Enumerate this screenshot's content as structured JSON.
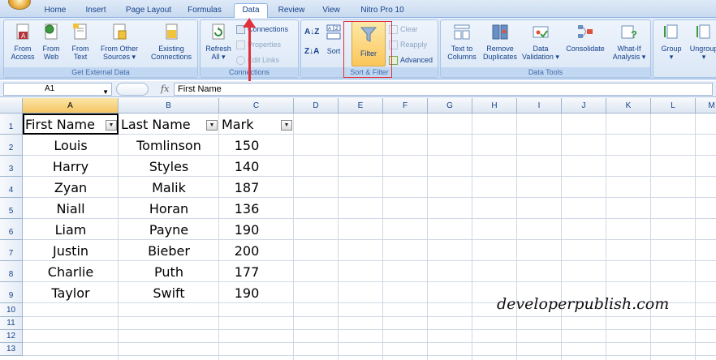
{
  "tabs": [
    "Home",
    "Insert",
    "Page Layout",
    "Formulas",
    "Data",
    "Review",
    "View",
    "Nitro Pro 10"
  ],
  "active_tab": "Data",
  "ribbon": {
    "get_external_data": {
      "label": "Get External Data",
      "from_access": [
        "From",
        "Access"
      ],
      "from_web": [
        "From",
        "Web"
      ],
      "from_text": [
        "From",
        "Text"
      ],
      "from_other": [
        "From Other",
        "Sources ▾"
      ],
      "existing": [
        "Existing",
        "Connections"
      ]
    },
    "connections": {
      "label": "Connections",
      "refresh": [
        "Refresh",
        "All ▾"
      ],
      "connections": "Connections",
      "properties": "Properties",
      "edit_links": "Edit Links"
    },
    "sort_filter": {
      "label": "Sort & Filter",
      "sort_az": "A↓Z",
      "sort_za": "Z↓A",
      "sort": "Sort",
      "filter": "Filter",
      "clear": "Clear",
      "reapply": "Reapply",
      "advanced": "Advanced"
    },
    "data_tools": {
      "label": "Data Tools",
      "text_to_columns": [
        "Text to",
        "Columns"
      ],
      "remove_duplicates": [
        "Remove",
        "Duplicates"
      ],
      "data_validation": [
        "Data",
        "Validation ▾"
      ],
      "consolidate": "Consolidate",
      "what_if": [
        "What-If",
        "Analysis ▾"
      ]
    },
    "outline": {
      "group": [
        "Group",
        "▾"
      ],
      "ungroup": [
        "Ungroup",
        "▾"
      ]
    }
  },
  "formula_bar": {
    "name_box": "A1",
    "fx": "fx",
    "value": "First Name"
  },
  "columns": [
    "A",
    "B",
    "C",
    "D",
    "E",
    "F",
    "G",
    "H",
    "I",
    "J",
    "K",
    "L",
    "M"
  ],
  "rows": [
    "1",
    "2",
    "3",
    "4",
    "5",
    "6",
    "7",
    "8",
    "9",
    "10",
    "11",
    "12",
    "13"
  ],
  "table": {
    "headers": [
      "First Name",
      "Last Name",
      "Mark"
    ],
    "rows": [
      [
        "Louis",
        "Tomlinson",
        "150"
      ],
      [
        "Harry",
        "Styles",
        "140"
      ],
      [
        "Zyan",
        "Malik",
        "187"
      ],
      [
        "Niall",
        "Horan",
        "136"
      ],
      [
        "Liam",
        "Payne",
        "190"
      ],
      [
        "Justin",
        "Bieber",
        "200"
      ],
      [
        "Charlie",
        "Puth",
        "177"
      ],
      [
        "Taylor",
        "Swift",
        "190"
      ]
    ]
  },
  "watermark": "developerpublish.com",
  "colors": {
    "highlight": "#e0313a",
    "ribbon": "#dbe7f6",
    "filter_active": "#fbd36b"
  }
}
